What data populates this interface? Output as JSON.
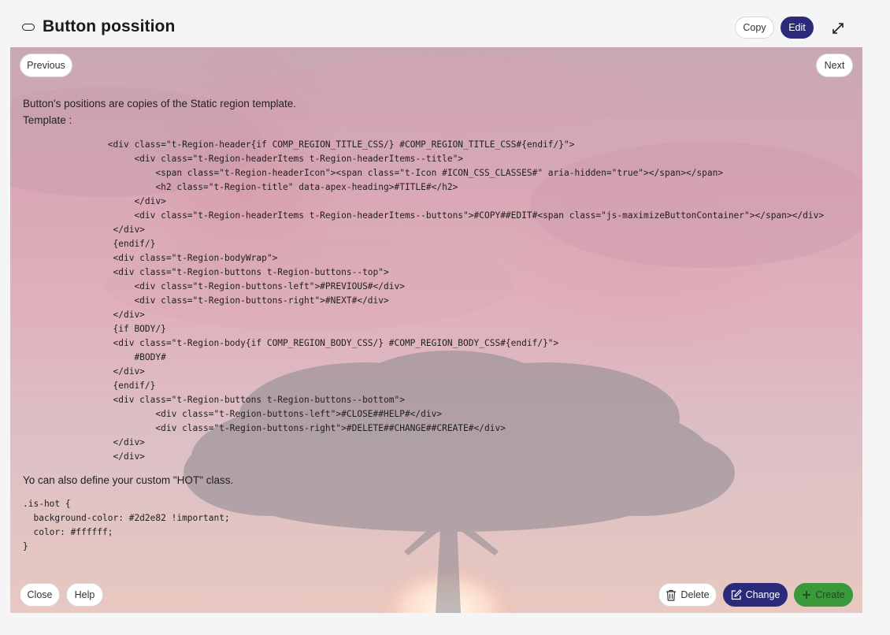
{
  "header": {
    "title": "Button possition",
    "copy_label": "Copy",
    "edit_label": "Edit"
  },
  "region": {
    "previous_label": "Previous",
    "next_label": "Next",
    "intro_line1": "Button's positions are copies of the Static region template.",
    "intro_line2": "Template :",
    "template_code": "                <div class=\"t-Region-header{if COMP_REGION_TITLE_CSS/} #COMP_REGION_TITLE_CSS#{endif/}\">\n                     <div class=\"t-Region-headerItems t-Region-headerItems--title\">\n                         <span class=\"t-Region-headerIcon\"><span class=\"t-Icon #ICON_CSS_CLASSES#\" aria-hidden=\"true\"></span></span>\n                         <h2 class=\"t-Region-title\" data-apex-heading>#TITLE#</h2>\n                     </div>\n                     <div class=\"t-Region-headerItems t-Region-headerItems--buttons\">#COPY##EDIT#<span class=\"js-maximizeButtonContainer\"></span></div>\n                 </div>\n                 {endif/}\n                 <div class=\"t-Region-bodyWrap\">\n                 <div class=\"t-Region-buttons t-Region-buttons--top\">\n                     <div class=\"t-Region-buttons-left\">#PREVIOUS#</div>\n                     <div class=\"t-Region-buttons-right\">#NEXT#</div>\n                 </div>\n                 {if BODY/}\n                 <div class=\"t-Region-body{if COMP_REGION_BODY_CSS/} #COMP_REGION_BODY_CSS#{endif/}\">\n                     #BODY#\n                 </div>\n                 {endif/}\n                 <div class=\"t-Region-buttons t-Region-buttons--bottom\">\n                         <div class=\"t-Region-buttons-left\">#CLOSE##HELP#</div>\n                         <div class=\"t-Region-buttons-right\">#DELETE##CHANGE##CREATE#</div>\n                 </div>\n                 </div>",
    "hot_text": "Yo can also define your custom \"HOT\" class.",
    "hot_code": ".is-hot {\n  background-color: #2d2e82 !important;\n  color: #ffffff;\n}",
    "close_label": "Close",
    "help_label": "Help",
    "delete_label": "Delete",
    "change_label": "Change",
    "create_label": "Create"
  },
  "colors": {
    "edit_bg": "#2b2a7a",
    "change_bg": "#2b2a7a",
    "create_bg": "#3a9a3a",
    "page_bg": "#f5f5f5"
  },
  "icons": {
    "title": "region-pill-icon",
    "maximize": "expand-arrows-icon",
    "delete": "trash-icon",
    "change": "edit-pencil-icon",
    "create": "plus-icon"
  }
}
